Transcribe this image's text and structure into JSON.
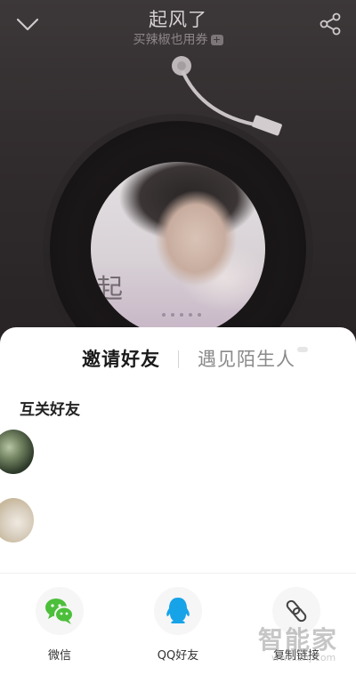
{
  "player": {
    "title": "起风了",
    "artist": "买辣椒也用券",
    "artist_badge": "+"
  },
  "cover": {
    "glyph": "起"
  },
  "sheet": {
    "tabs": {
      "invite": "邀请好友",
      "stranger": "遇见陌生人"
    },
    "section_title": "互关好友",
    "share_options": {
      "wechat": "微信",
      "qq": "QQ好友",
      "copy_link": "复制链接"
    }
  },
  "watermark": {
    "text": "智能家",
    "url": "www.znj.com"
  },
  "colors": {
    "wechat_green": "#4cbf3a",
    "qq_blue": "#16a3e8"
  },
  "icons": [
    "chevron-down-icon",
    "share-icon",
    "wechat-icon",
    "qq-icon",
    "link-icon"
  ]
}
